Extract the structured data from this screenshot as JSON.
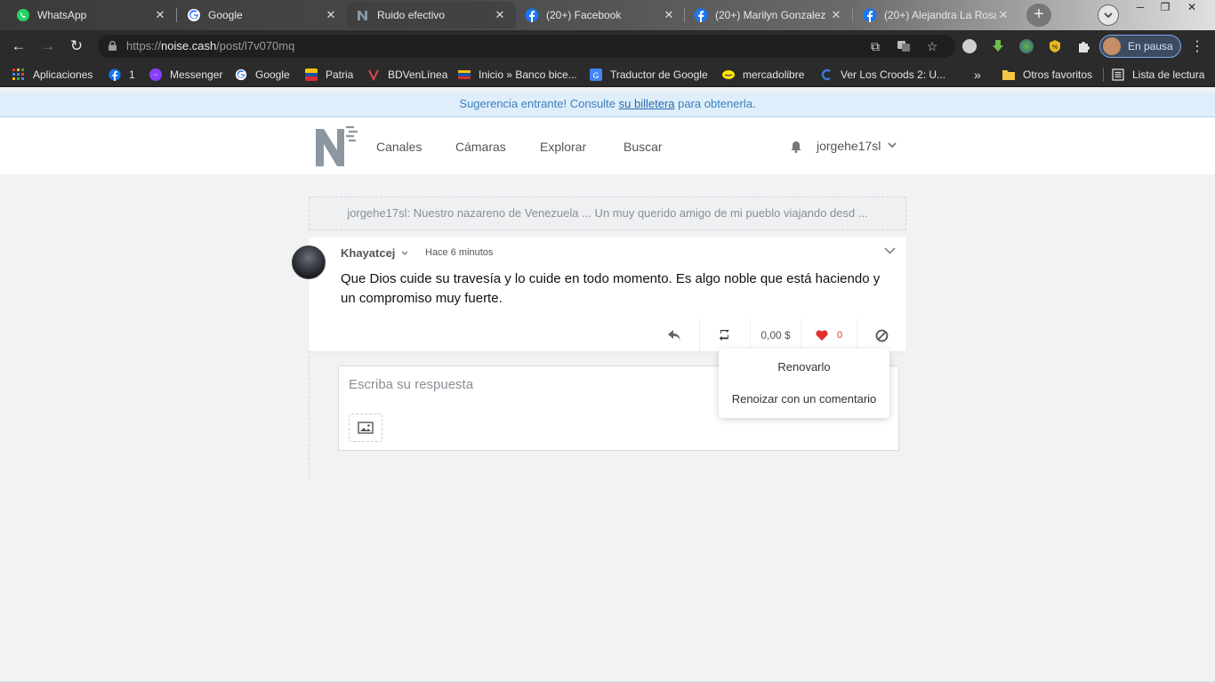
{
  "browser": {
    "tabs": [
      {
        "title": "WhatsApp",
        "icon": "whatsapp-icon"
      },
      {
        "title": "Google",
        "icon": "google-icon"
      },
      {
        "title": "Ruido efectivo",
        "icon": "noise-cash-icon"
      },
      {
        "title": "(20+) Facebook",
        "icon": "facebook-icon"
      },
      {
        "title": "(20+) Marilyn Gonzalez",
        "icon": "facebook-icon"
      },
      {
        "title": "(20+) Alejandra La Rosa",
        "icon": "facebook-icon"
      }
    ],
    "url_host": "noise.cash",
    "url_prefix": "https://",
    "url_path": "/post/l7v070mq",
    "profile_status": "En pausa",
    "bookmarks": [
      {
        "label": "Aplicaciones",
        "icon": "apps-grid-icon"
      },
      {
        "label": "1",
        "icon": "facebook-icon"
      },
      {
        "label": "Messenger",
        "icon": "messenger-icon"
      },
      {
        "label": "Google",
        "icon": "google-icon"
      },
      {
        "label": "Patria",
        "icon": "patria-icon"
      },
      {
        "label": "BDVenLínea",
        "icon": "bdv-icon"
      },
      {
        "label": "Inicio » Banco bice...",
        "icon": "bicentenario-icon"
      },
      {
        "label": "Traductor de Google",
        "icon": "translate-icon"
      },
      {
        "label": "mercadolibre",
        "icon": "mercadolibre-icon"
      },
      {
        "label": "Ver Los Croods 2: U...",
        "icon": "croods-icon"
      }
    ],
    "bookmarks_overflow": "»",
    "other_bookmarks": "Otros favoritos",
    "reading_list": "Lista de lectura"
  },
  "notice": {
    "prefix": "Sugerencia entrante! Consulte ",
    "link": "su billetera",
    "suffix": " para obtenerla."
  },
  "header": {
    "nav": [
      "Canales",
      "Cámaras",
      "Explorar",
      "Buscar"
    ],
    "username": "jorgehe17sl"
  },
  "parent_post": {
    "preview": "jorgehe17sl: Nuestro nazareno de Venezuela ... Un muy querido amigo de mi pueblo viajando desd ..."
  },
  "post": {
    "author": "Khayatcej",
    "time": "Hace 6 minutos",
    "body": "Que Dios cuide su travesía y lo cuide en todo momento. Es algo noble que está haciendo y un compromiso muy fuerte.",
    "tip_amount": "0,00 $",
    "likes": "0"
  },
  "renoise_menu": {
    "items": [
      "Renovarlo",
      "Renoizar con un comentario"
    ]
  },
  "reply": {
    "placeholder": "Escriba su respuesta"
  },
  "colors": {
    "notice_bg": "#dfeefb",
    "notice_text": "#3d7fbd",
    "like_red": "#e0312b",
    "page_bg": "#f1f2f4"
  }
}
